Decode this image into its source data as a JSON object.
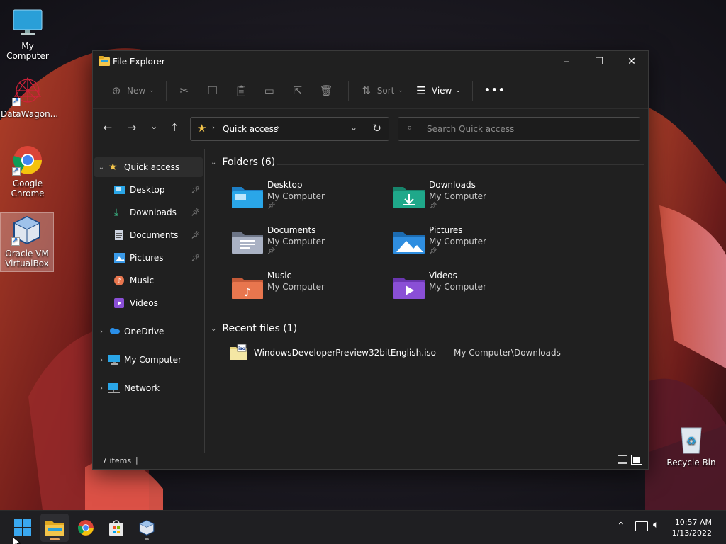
{
  "desktop": {
    "icons": [
      {
        "label": "My Computer"
      },
      {
        "label": "DataWagon..."
      },
      {
        "label": "Google Chrome"
      },
      {
        "label": "Oracle VM VirtualBox"
      },
      {
        "label": "Recycle Bin"
      }
    ]
  },
  "window": {
    "title": "File Explorer",
    "controls": {
      "minimize": "─",
      "maximize": "☐",
      "close": "✕"
    }
  },
  "commandbar": {
    "new_label": "New",
    "sort_label": "Sort",
    "view_label": "View",
    "more_label": "•••"
  },
  "navbar": {
    "back": "←",
    "forward": "→",
    "recent": "⌄",
    "up": "↑",
    "address_location": "Quick access",
    "search_placeholder": "Search Quick access"
  },
  "sidebar": {
    "items": [
      {
        "label": "Quick access",
        "icon": "star-icon"
      },
      {
        "label": "Desktop",
        "icon": "desktop-folder-icon",
        "pinned": true
      },
      {
        "label": "Downloads",
        "icon": "download-icon",
        "pinned": true
      },
      {
        "label": "Documents",
        "icon": "documents-icon",
        "pinned": true
      },
      {
        "label": "Pictures",
        "icon": "pictures-icon",
        "pinned": true
      },
      {
        "label": "Music",
        "icon": "music-icon"
      },
      {
        "label": "Videos",
        "icon": "videos-icon"
      },
      {
        "label": "OneDrive",
        "icon": "cloud-icon"
      },
      {
        "label": "My Computer",
        "icon": "computer-icon"
      },
      {
        "label": "Network",
        "icon": "network-icon"
      }
    ]
  },
  "content": {
    "folders_header": "Folders (6)",
    "folders": [
      {
        "name": "Desktop",
        "location": "My Computer",
        "pinned": true,
        "color": "#2aa6e8"
      },
      {
        "name": "Downloads",
        "location": "My Computer",
        "pinned": true,
        "color": "#1fa88a"
      },
      {
        "name": "Documents",
        "location": "My Computer",
        "pinned": true,
        "color": "#8a93a6"
      },
      {
        "name": "Pictures",
        "location": "My Computer",
        "pinned": true,
        "color": "#2f8ee0"
      },
      {
        "name": "Music",
        "location": "My Computer",
        "pinned": false,
        "color": "#e8764e"
      },
      {
        "name": "Videos",
        "location": "My Computer",
        "pinned": false,
        "color": "#8a4fd6"
      }
    ],
    "recent_header": "Recent files (1)",
    "recent_files": [
      {
        "name": "WindowsDeveloperPreview32bitEnglish.iso",
        "path": "My Computer\\Downloads"
      }
    ]
  },
  "statusbar": {
    "items_count": "7 items"
  },
  "taskbar": {
    "time": "10:57 AM",
    "date": "1/13/2022"
  }
}
